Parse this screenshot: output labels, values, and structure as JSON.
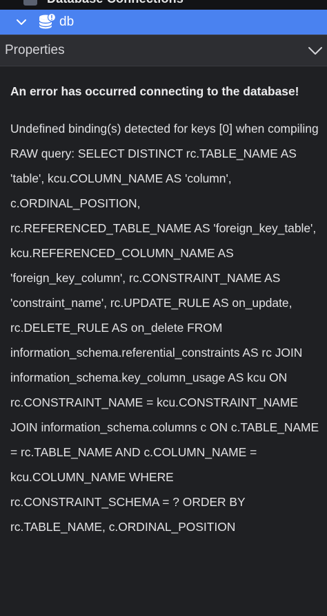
{
  "tree": {
    "partial_item_label": "Database Connections",
    "selected_item_label": "db",
    "selected_item_icon": "database-icon",
    "expand_icon": "chevron-down-icon"
  },
  "properties": {
    "title": "Properties",
    "collapse_icon": "chevron-down-icon"
  },
  "error": {
    "title": "An error has occurred connecting to the database!",
    "message": "Undefined binding(s) detected for keys [0] when compiling RAW query: SELECT DISTINCT rc.TABLE_NAME AS 'table', kcu.COLUMN_NAME AS 'column', c.ORDINAL_POSITION, rc.REFERENCED_TABLE_NAME AS 'foreign_key_table', kcu.REFERENCED_COLUMN_NAME AS 'foreign_key_column', rc.CONSTRAINT_NAME AS 'constraint_name', rc.UPDATE_RULE AS on_update, rc.DELETE_RULE AS on_delete FROM information_schema.referential_constraints AS rc JOIN information_schema.key_column_usage AS kcu ON rc.CONSTRAINT_NAME = kcu.CONSTRAINT_NAME JOIN information_schema.columns c ON c.TABLE_NAME = rc.TABLE_NAME AND c.COLUMN_NAME = kcu.COLUMN_NAME WHERE rc.CONSTRAINT_SCHEMA = ? ORDER BY rc.TABLE_NAME, c.ORDINAL_POSITION"
  },
  "colors": {
    "selection": "#4a82f0",
    "panel_bg": "#1f2023",
    "header_bg": "#2d2e32"
  }
}
